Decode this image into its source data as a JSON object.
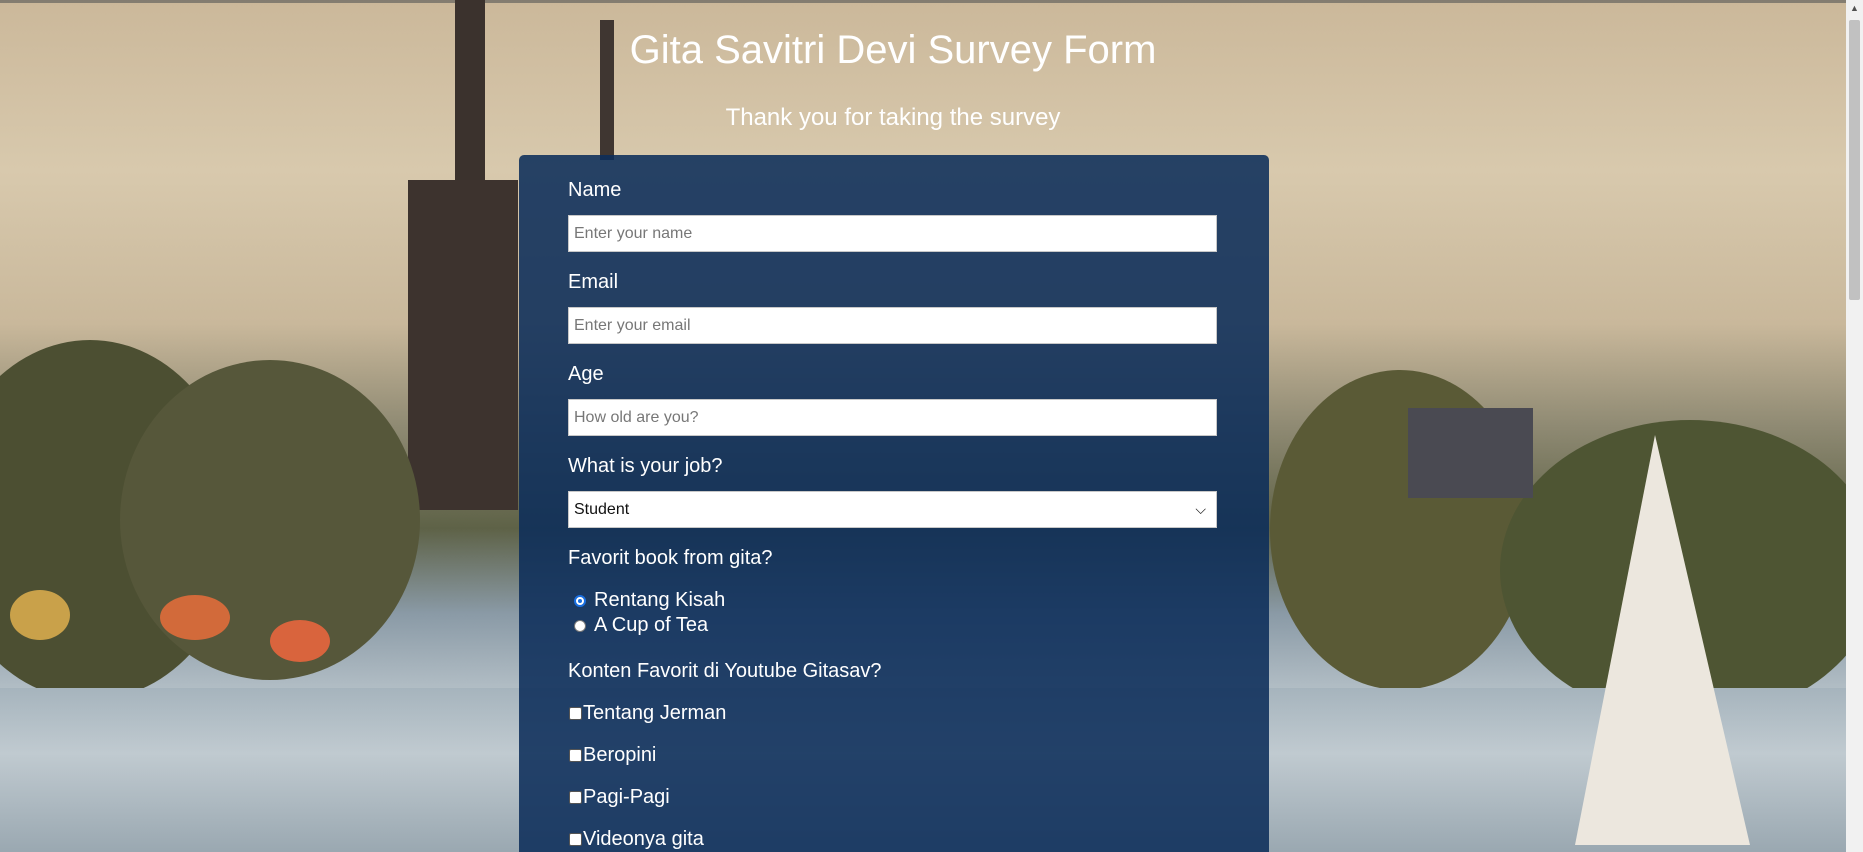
{
  "header": {
    "title": "Gita Savitri Devi Survey Form",
    "subtitle": "Thank you for taking the survey"
  },
  "form": {
    "name": {
      "label": "Name",
      "placeholder": "Enter your name"
    },
    "email": {
      "label": "Email",
      "placeholder": "Enter your email"
    },
    "age": {
      "label": "Age",
      "placeholder": "How old are you?"
    },
    "job": {
      "label": "What is your job?",
      "selected": "Student"
    },
    "book": {
      "label": "Favorit book from gita?",
      "options": [
        {
          "label": "Rentang Kisah",
          "checked": true
        },
        {
          "label": "A Cup of Tea",
          "checked": false
        }
      ]
    },
    "content": {
      "label": "Konten Favorit di Youtube Gitasav?",
      "options": [
        {
          "label": "Tentang Jerman"
        },
        {
          "label": "Beropini"
        },
        {
          "label": "Pagi-Pagi"
        },
        {
          "label": "Videonya gita"
        }
      ]
    }
  },
  "icons": {
    "select": "chevron-down-icon",
    "scroll_up": "scroll-up-arrow-icon"
  },
  "colors": {
    "card_bg": "#0c2d5a",
    "text": "#ffffff",
    "radio_accent": "#1a6fe0"
  }
}
